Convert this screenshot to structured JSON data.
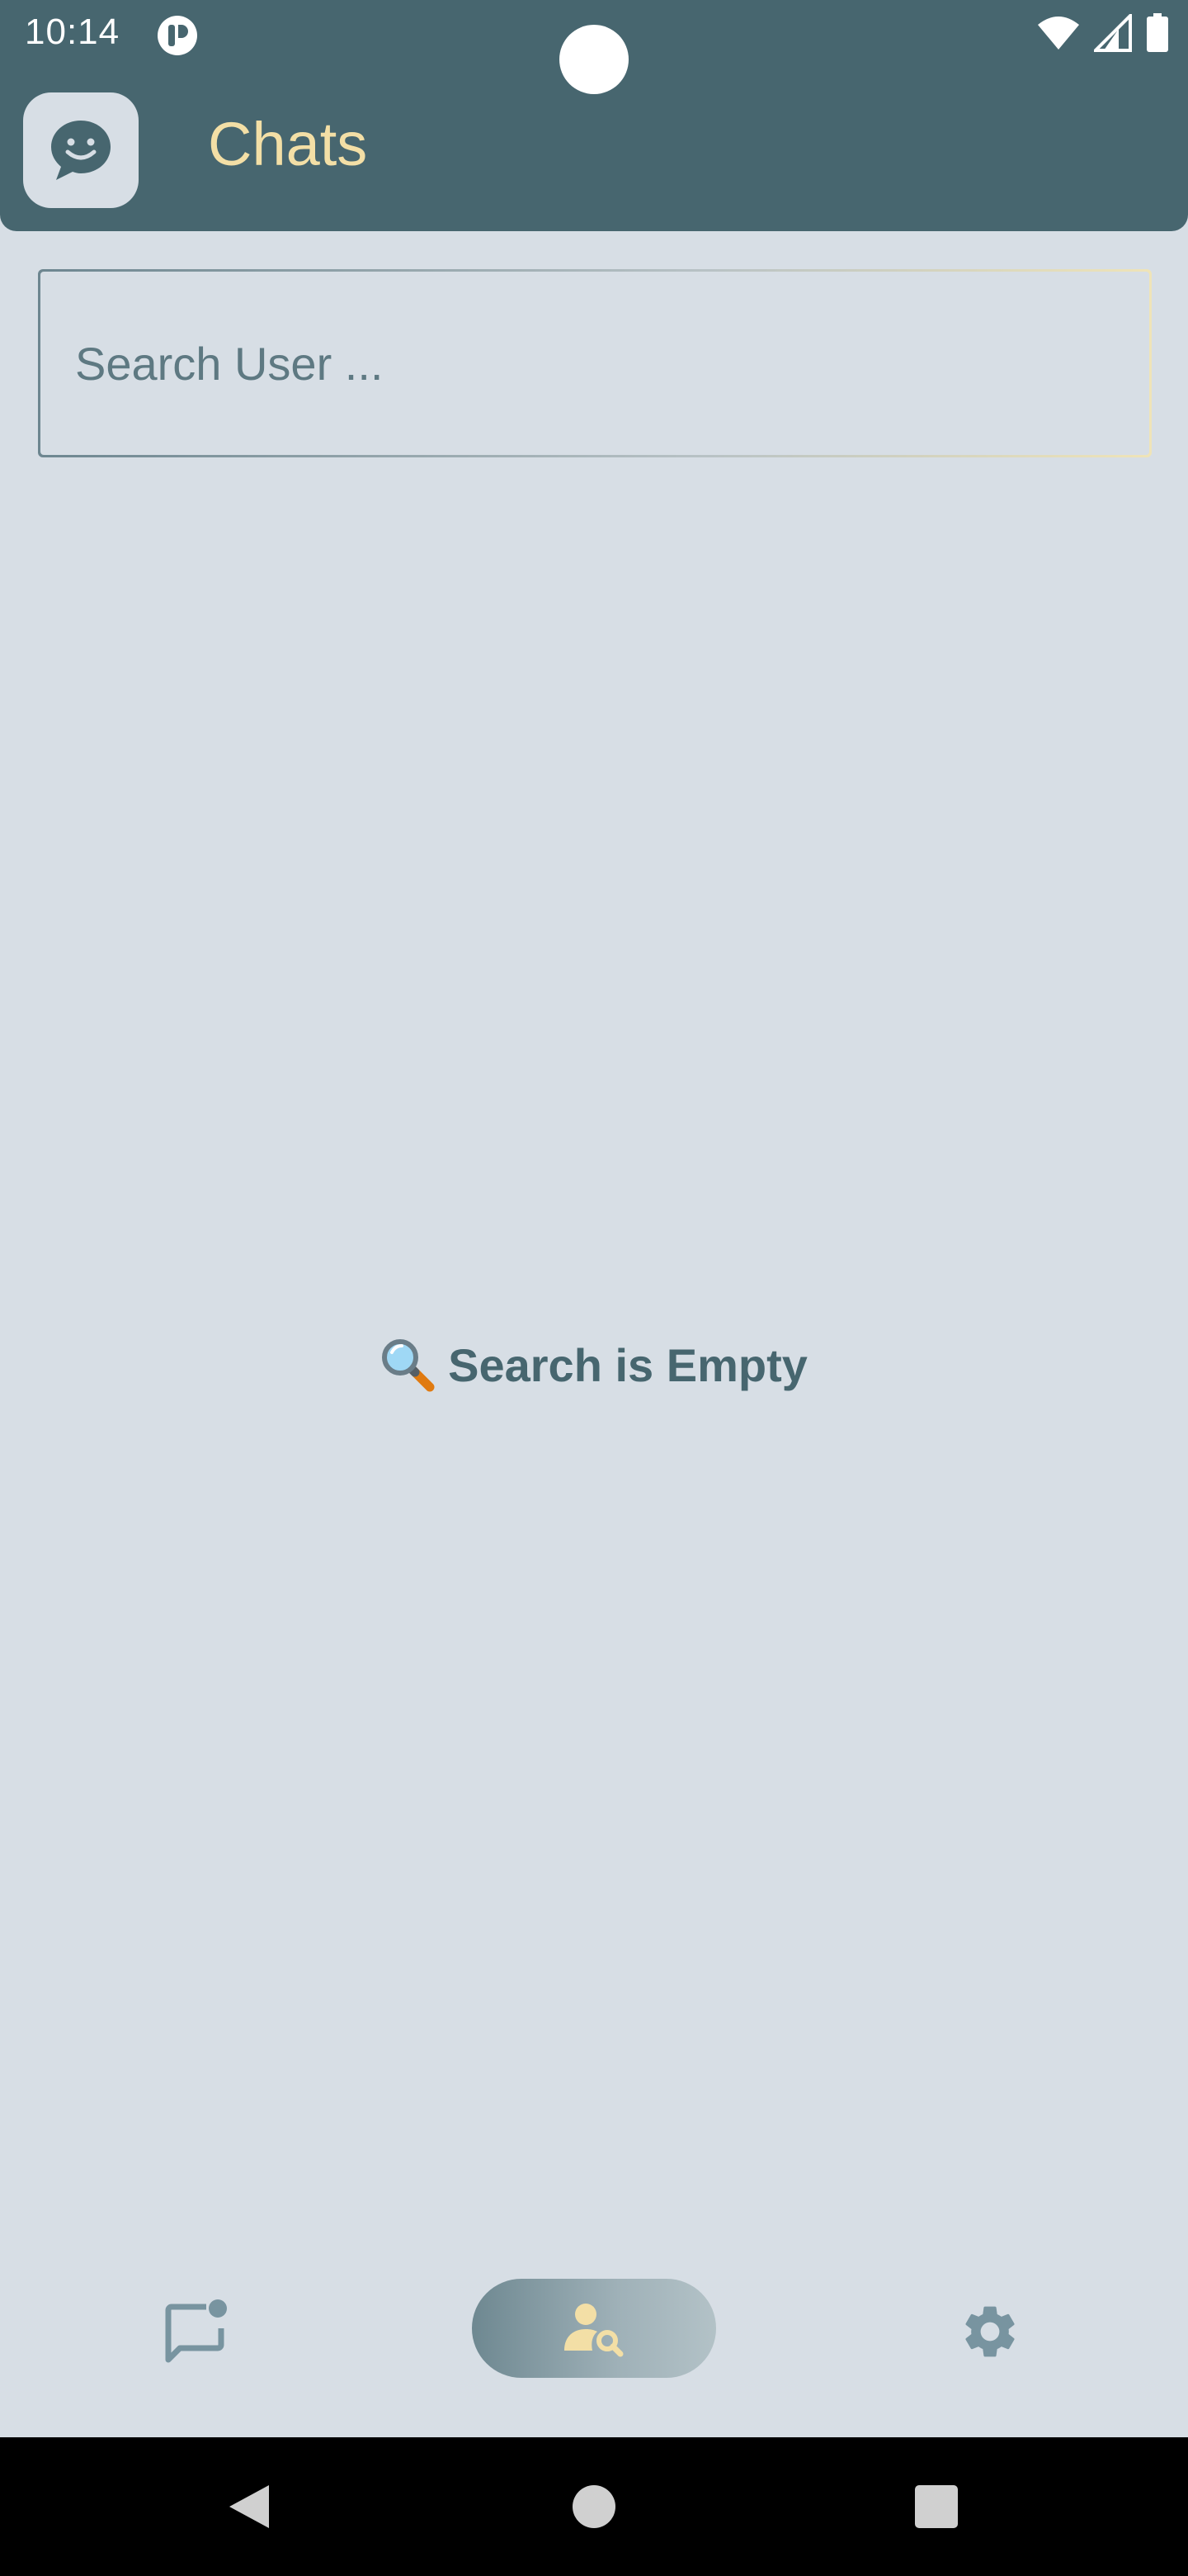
{
  "status_bar": {
    "time": "10:14"
  },
  "header": {
    "title": "Chats",
    "logo_icon": "chat-smile-icon"
  },
  "search": {
    "placeholder": "Search User ..."
  },
  "empty_state": {
    "icon": "magnifier-emoji",
    "message": "Search is Empty"
  },
  "bottom_nav": {
    "items": [
      {
        "name": "chats",
        "icon": "chat-notification-icon",
        "active": false
      },
      {
        "name": "search-users",
        "icon": "person-search-icon",
        "active": true
      },
      {
        "name": "settings",
        "icon": "gear-icon",
        "active": false
      }
    ]
  },
  "colors": {
    "primary": "#47666f",
    "background": "#d7dee5",
    "accent": "#f3dfa6",
    "nav_inactive": "#7894a0"
  }
}
